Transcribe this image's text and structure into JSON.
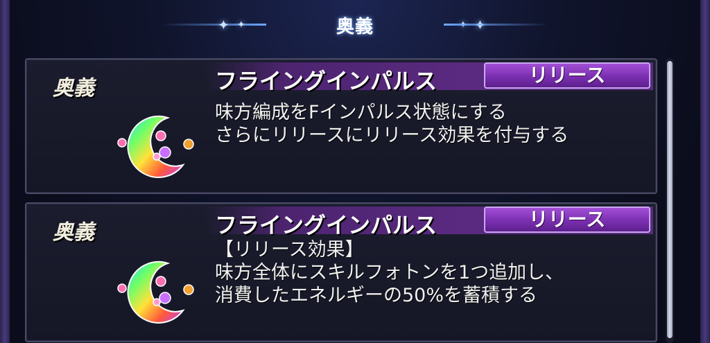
{
  "header": {
    "title": "奥義"
  },
  "panels": [
    {
      "label": "奥義",
      "skill_name": "フライングインパルス",
      "button_label": "リリース",
      "description": [
        "味方編成をFインパルス状態にする",
        "さらにリリースにリリース効果を付与する"
      ]
    },
    {
      "label": "奥義",
      "skill_name": "フライングインパルス",
      "button_label": "リリース",
      "description": [
        "【リリース効果】",
        "味方全体にスキルフォトンを1つ追加し、",
        "消費したエネルギーの50%を蓄積する"
      ]
    }
  ],
  "colors": {
    "accent_purple": "#7a2fb0",
    "header_glow": "#7fb2ff"
  },
  "icons": {
    "skill_icon": "rainbow-crescent-moon-icon"
  }
}
